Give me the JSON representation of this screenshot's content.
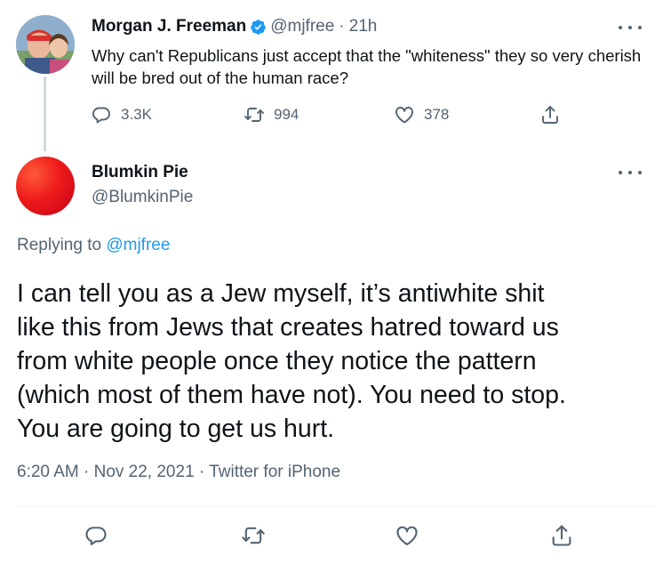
{
  "parent_tweet": {
    "author_name": "Morgan J. Freeman",
    "handle": "@mjfree",
    "separator": "·",
    "age": "21h",
    "text": "Why can't Republicans just accept that the \"whiteness\" they so very cherish will be bred out of the human race?",
    "reply_count": "3.3K",
    "retweet_count": "994",
    "like_count": "378"
  },
  "reply_tweet": {
    "author_name": "Blumkin Pie",
    "handle": "@BlumkinPie",
    "replying_prefix": "Replying to",
    "replying_to": "@mjfree",
    "text_lines": [
      "I can tell you as a Jew myself, it’s antiwhite shit",
      "like this from Jews that creates hatred toward us",
      "from white people once they notice the pattern",
      "(which most of them have not). You need to stop.",
      "You are going to get us hurt."
    ],
    "time": "6:20 AM",
    "date": "Nov 22, 2021",
    "source": "Twitter for iPhone",
    "meta_separator": "·"
  },
  "colors": {
    "accent": "#1d9bf0",
    "muted": "#536471",
    "text": "#0f1419",
    "divider": "#eff3f4",
    "thread_line": "#cfd9de"
  },
  "icons": {
    "verified": "verified-badge-icon",
    "reply": "reply-icon",
    "retweet": "retweet-icon",
    "like": "heart-icon",
    "share": "share-icon",
    "more": "more-icon"
  }
}
